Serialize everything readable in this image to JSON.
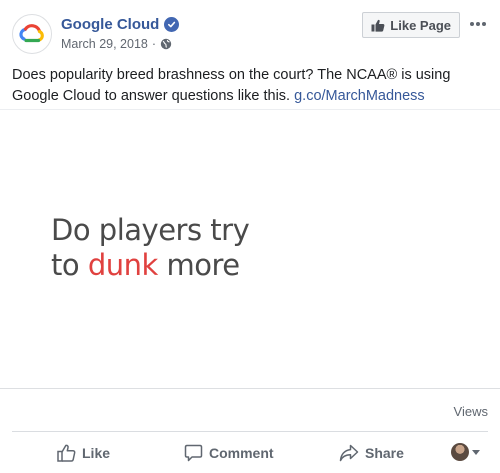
{
  "page": {
    "name": "Google Cloud",
    "verified": true,
    "date": "March 29, 2018",
    "separator": "·",
    "like_page_label": "Like Page"
  },
  "post": {
    "text": "Does popularity breed brashness on the court? The NCAA® is using Google Cloud to answer questions like this.",
    "link_text": "g.co/MarchMadness"
  },
  "media": {
    "line1": "Do players try",
    "line2_prefix": "to ",
    "line2_accent": "dunk",
    "line2_suffix": " more",
    "accent_color": "#e0413f",
    "text_color": "#4a4a4a"
  },
  "stats": {
    "views_label": "Views"
  },
  "actions": {
    "like_label": "Like",
    "comment_label": "Comment",
    "share_label": "Share"
  },
  "icons": {
    "logo": "google-cloud-logo",
    "verified": "verified-check-icon",
    "globe": "globe-icon",
    "thumbs_up": "thumbs-up-icon",
    "comment": "comment-bubble-icon",
    "share": "share-arrow-icon",
    "more": "more-dots-icon",
    "caret": "caret-down-icon"
  },
  "colors": {
    "link": "#365899",
    "brand_blue": "#4267b2",
    "secondary_text": "#606770"
  }
}
